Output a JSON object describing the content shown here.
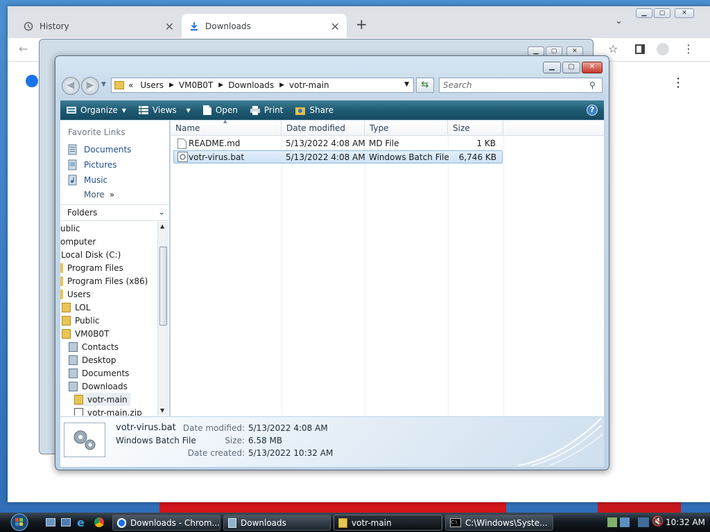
{
  "chrome": {
    "tabs": [
      {
        "label": "History",
        "icon": "history-icon",
        "active": false
      },
      {
        "label": "Downloads",
        "icon": "download-icon",
        "active": true
      }
    ],
    "new_tab_label": "+"
  },
  "explorer": {
    "breadcrumb": [
      "«",
      "Users",
      "VM0B0T",
      "Downloads",
      "votr-main"
    ],
    "search_placeholder": "Search",
    "commands": [
      "Organize",
      "Views",
      "Open",
      "Print",
      "Share"
    ],
    "favorite_links": {
      "header": "Favorite Links",
      "items": [
        "Documents",
        "Pictures",
        "Music",
        "More"
      ]
    },
    "folders_header": "Folders",
    "tree": [
      "ublic",
      "omputer",
      "Local Disk (C:)",
      "Program Files",
      "Program Files (x86)",
      "Users",
      "LOL",
      "Public",
      "VM0B0T",
      "Contacts",
      "Desktop",
      "Documents",
      "Downloads",
      "votr-main",
      "votr-main.zip"
    ],
    "columns": [
      "Name",
      "Date modified",
      "Type",
      "Size"
    ],
    "files": [
      {
        "name": "README.md",
        "date": "5/13/2022 4:08 AM",
        "type": "MD File",
        "size": "1 KB"
      },
      {
        "name": "votr-virus.bat",
        "date": "5/13/2022 4:08 AM",
        "type": "Windows Batch File",
        "size": "6,746 KB"
      }
    ],
    "details": {
      "name": "votr-virus.bat",
      "kind": "Windows Batch File",
      "date_modified_label": "Date modified:",
      "date_modified": "5/13/2022 4:08 AM",
      "size_label": "Size:",
      "size": "6.58 MB",
      "date_created_label": "Date created:",
      "date_created": "5/13/2022 10:32 AM"
    }
  },
  "taskbar": {
    "items": [
      "Downloads - Chrom...",
      "Downloads",
      "votr-main",
      "C:\\Windows\\Syste..."
    ],
    "clock": "10:32 AM"
  },
  "colors": {
    "command_bar": "#1f5a71",
    "selection": "#cde2f6",
    "desktop_red": "#d4141b"
  }
}
